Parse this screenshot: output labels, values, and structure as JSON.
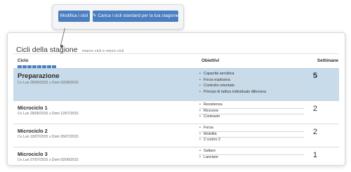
{
  "toolbar": {
    "modify_label": "Modifica i cicli",
    "load_label": "Carica i cicli standard per la tua stagione",
    "pencil_icon": "pencil-icon"
  },
  "panel": {
    "title": "Cicli della stagione",
    "subtitle": "macro cicli e micro cicli"
  },
  "columns": {
    "ciclo": "Ciclo",
    "obiettivi": "Obiettivi",
    "settimane": "Settimane"
  },
  "progress": {
    "segments": 8,
    "color": "#4a7fc1"
  },
  "rows": [
    {
      "name": "Preparazione",
      "dates_prefix": "Da",
      "start": "Lun 29/06/2015",
      "dates_mid": "a",
      "end": "Dom 02/08/2015",
      "goals": [
        "Capacità aerobica",
        "Forza esplosiva",
        "Controllo orientato",
        "Principi di tattica individuale difensiva"
      ],
      "weeks": "5",
      "selected": true
    },
    {
      "name": "Microciclo 1",
      "dates_prefix": "Da",
      "start": "Lun 29/06/2015",
      "dates_mid": "a",
      "end": "Dom 12/07/2015",
      "goals": [
        "Resistenza",
        "Ricevere",
        "Contrasto"
      ],
      "weeks": "2",
      "selected": false
    },
    {
      "name": "Microciclo 2",
      "dates_prefix": "Da",
      "start": "Lun 13/07/2015",
      "dates_mid": "a",
      "end": "Dom 26/07/2015",
      "goals": [
        "Forza",
        "Mobilità",
        "2 contro 2"
      ],
      "weeks": "2",
      "selected": false
    },
    {
      "name": "Microciclo 3",
      "dates_prefix": "Da",
      "start": "Lun 27/07/2015",
      "dates_mid": "a",
      "end": "Dom 02/08/2015",
      "goals": [
        "Saltare",
        "Lanciare"
      ],
      "weeks": "1",
      "selected": false
    }
  ]
}
